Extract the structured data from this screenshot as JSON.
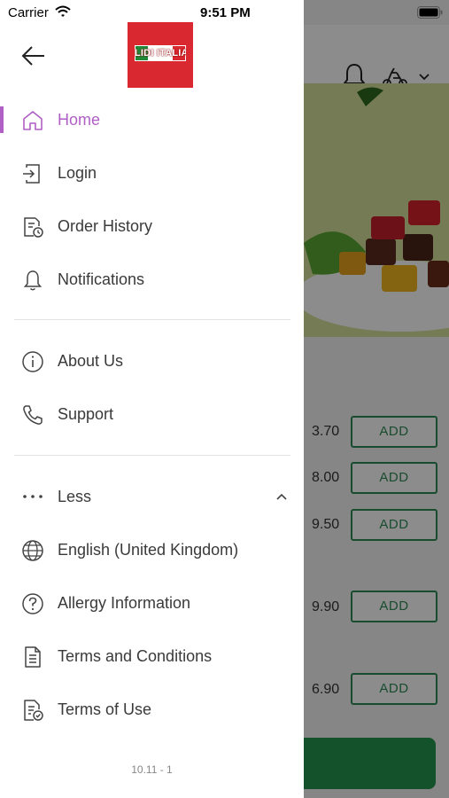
{
  "status_bar": {
    "carrier": "Carrier",
    "time": "9:51 PM"
  },
  "brand": {
    "logo_text": "LIDI ITALIA"
  },
  "menu": {
    "primary": [
      {
        "label": "Home",
        "icon": "home-icon",
        "active": true
      },
      {
        "label": "Login",
        "icon": "login-icon"
      },
      {
        "label": "Order History",
        "icon": "order-history-icon"
      },
      {
        "label": "Notifications",
        "icon": "bell-icon"
      }
    ],
    "secondary": [
      {
        "label": "About Us",
        "icon": "info-icon"
      },
      {
        "label": "Support",
        "icon": "phone-icon"
      }
    ],
    "more_toggle": {
      "label": "Less",
      "icon": "more-dots-icon"
    },
    "extra": [
      {
        "label": "English (United Kingdom)",
        "icon": "globe-icon"
      },
      {
        "label": "Allergy Information",
        "icon": "question-icon"
      },
      {
        "label": "Terms and Conditions",
        "icon": "document-icon"
      },
      {
        "label": "Terms of Use",
        "icon": "document-check-icon"
      }
    ]
  },
  "version": "10.11 - 1",
  "background": {
    "items": [
      {
        "price": "3.70",
        "button": "ADD"
      },
      {
        "price": "8.00",
        "button": "ADD"
      },
      {
        "price": "9.50",
        "button": "ADD"
      },
      {
        "price": "9.90",
        "button": "ADD"
      },
      {
        "price": "6.90",
        "button": "ADD"
      }
    ]
  },
  "colors": {
    "accent": "#b05fc5",
    "add_green": "#2e8b57",
    "cta_green": "#23964f",
    "logo_red": "#d9282f"
  }
}
